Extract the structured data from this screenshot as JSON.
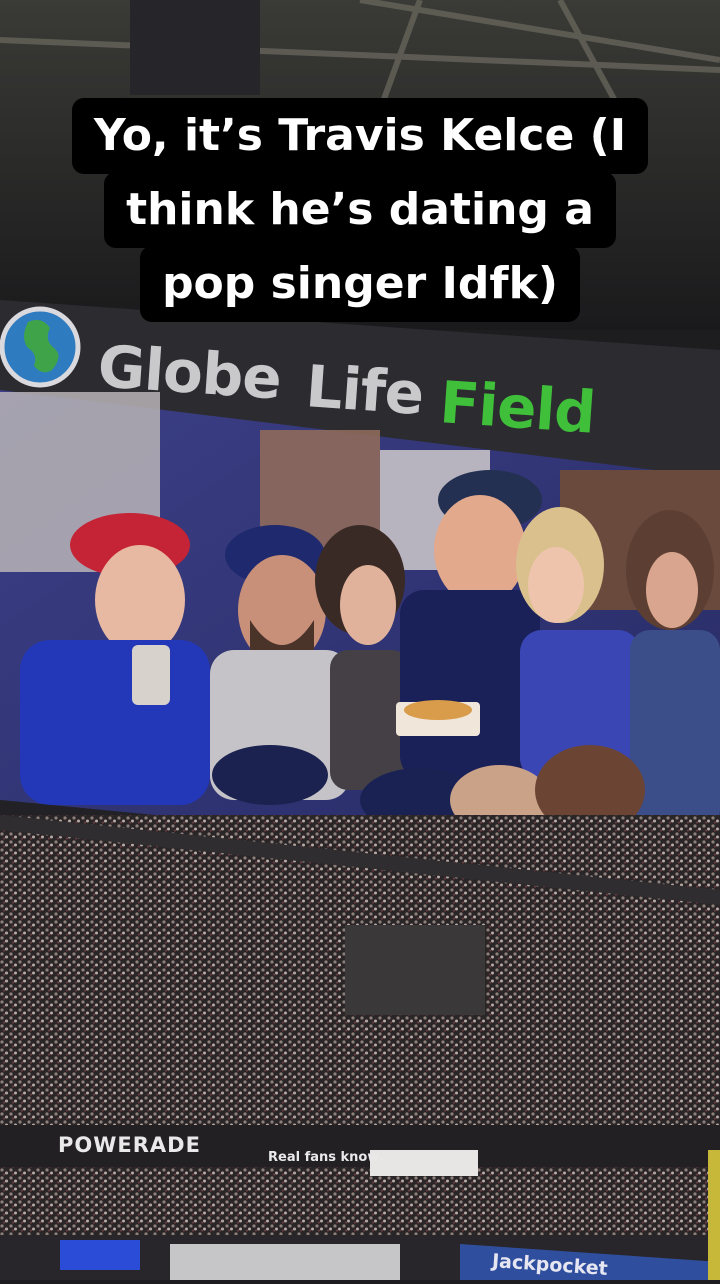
{
  "caption": {
    "lines": [
      "Yo, it’s Travis Kelce (I",
      "think he’s dating a",
      "pop singer Idfk)"
    ]
  },
  "signage": {
    "globe": "Globe",
    "life": "Life",
    "field": "Field",
    "powerade": "POWERADE",
    "real_fans": "Real fans know.",
    "jackpocket": "Jackpocket"
  },
  "colors": {
    "field_green": "#3fbf3a",
    "caption_bg": "#000000",
    "caption_text": "#ffffff"
  }
}
